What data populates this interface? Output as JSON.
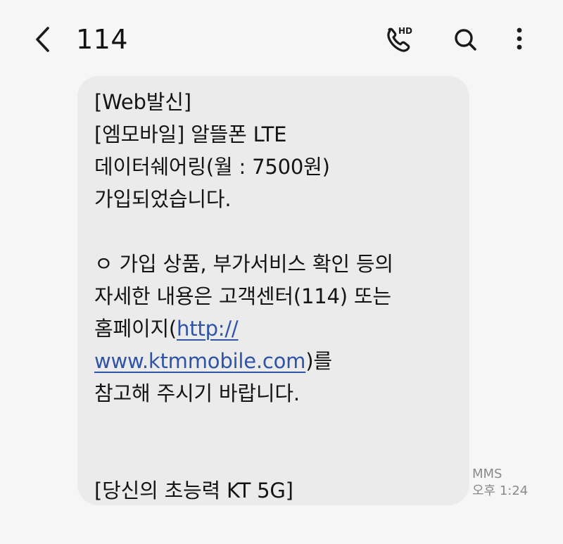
{
  "header": {
    "title": "114",
    "back_icon": "chevron-left-icon",
    "call_icon": "hd-voice-call-icon",
    "call_badge": "HD",
    "search_icon": "search-icon",
    "more_icon": "more-vertical-icon"
  },
  "message": {
    "lines": [
      "[Web발신]",
      "[엠모바일] 알뜰폰 LTE",
      "데이터쉐어링(월 : 7500원)",
      "가입되었습니다.",
      "",
      "ㅇ 가입 상품, 부가서비스 확인 등의",
      "자세한 내용은 고객센터(114) 또는",
      "홈페이지(",
      "",
      "참고해 주시기 바랍니다.",
      "",
      "",
      "[당신의 초능력 KT 5G]"
    ],
    "link_line1": "http://",
    "link_line2": "www.ktmmobile.com",
    "after_link": ")를",
    "type": "MMS",
    "time": "오후 1:24"
  },
  "colors": {
    "background": "#f6f6f6",
    "bubble": "#ebebeb",
    "link": "#2f53a7",
    "meta_text": "#8a8a8a"
  }
}
